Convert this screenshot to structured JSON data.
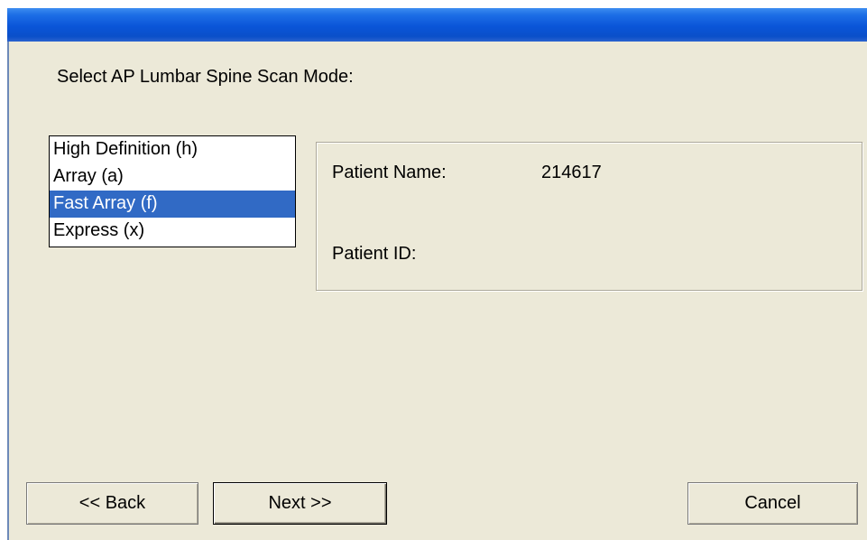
{
  "dialog": {
    "prompt": "Select AP Lumbar Spine Scan Mode:"
  },
  "scan_modes": {
    "items": [
      {
        "label": "High Definition (h)"
      },
      {
        "label": "Array (a)"
      },
      {
        "label": "Fast Array (f)"
      },
      {
        "label": "Express (x)"
      }
    ],
    "selected_index": 2
  },
  "patient": {
    "name_label": "Patient Name:",
    "name_value": "214617",
    "id_label": "Patient ID:",
    "id_value": ""
  },
  "buttons": {
    "back": "<< Back",
    "next": "Next >>",
    "cancel": "Cancel"
  },
  "colors": {
    "selection": "#316ac5",
    "dialog_background": "#ece9d8",
    "titlebar": "#0a55d8"
  }
}
